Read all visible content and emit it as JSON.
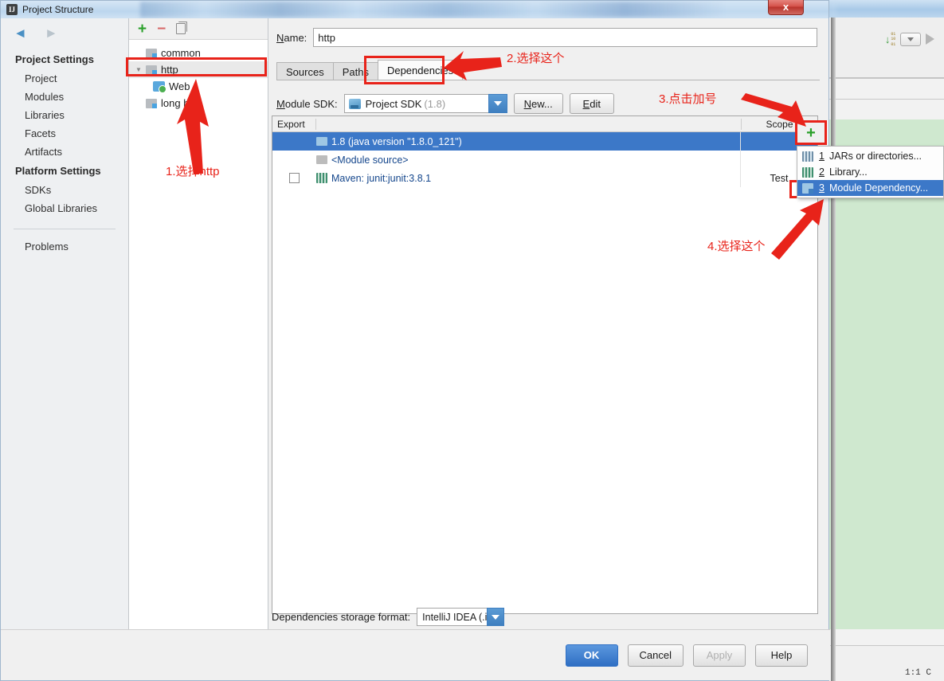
{
  "background": {
    "status_text": "1:1  C",
    "icons": [
      "binary-download-icon",
      "dropdown-icon",
      "run-icon"
    ]
  },
  "dialog": {
    "title": "Project Structure",
    "app_icon": "IJ",
    "close_label": "x"
  },
  "sidebar": {
    "back_icon": "◄",
    "forward_icon": "►",
    "groups": [
      {
        "title": "Project Settings",
        "items": [
          "Project",
          "Modules",
          "Libraries",
          "Facets",
          "Artifacts"
        ]
      },
      {
        "title": "Platform Settings",
        "items": [
          "SDKs",
          "Global Libraries"
        ]
      }
    ],
    "footer_items": [
      "Problems"
    ]
  },
  "module_tree": {
    "toolbar": {
      "add": "+",
      "remove": "−",
      "copy": "copy-icon"
    },
    "nodes": [
      {
        "label": "common",
        "icon": "module-icon",
        "indent": 0,
        "expander": "",
        "selected": false
      },
      {
        "label": "http",
        "icon": "module-icon",
        "indent": 0,
        "expander": "▼",
        "selected": true
      },
      {
        "label": "Web",
        "icon": "web-facet-icon",
        "indent": 1,
        "expander": "",
        "selected": false
      },
      {
        "label": "long  bo",
        "icon": "module-icon",
        "indent": 0,
        "expander": "",
        "selected": false
      }
    ]
  },
  "module_editor": {
    "name_label": "Name:",
    "name_label_mnemonic": "N",
    "name_value": "http",
    "tabs": [
      {
        "label": "Sources",
        "active": false
      },
      {
        "label": "Paths",
        "active": false
      },
      {
        "label": "Dependencies",
        "active": true
      }
    ],
    "sdk": {
      "label": "Module SDK:",
      "label_mnemonic": "M",
      "value": "Project SDK",
      "value_dim": "(1.8)",
      "new_button": "New...",
      "new_button_mnemonic": "N",
      "edit_button": "Edit",
      "edit_button_mnemonic": "E"
    },
    "table": {
      "columns": [
        "Export",
        "Scope"
      ],
      "rows": [
        {
          "export": null,
          "icon": "jdk-icon",
          "label": "1.8 (java version \"1.8.0_121\")",
          "scope": "",
          "selected": true
        },
        {
          "export": null,
          "icon": "folder-icon",
          "label": "<Module source>",
          "scope": "",
          "selected": false
        },
        {
          "export": false,
          "icon": "library-icon",
          "label": "Maven: junit:junit:3.8.1",
          "scope": "Test",
          "selected": false
        }
      ]
    },
    "add_button": "+",
    "add_menu": [
      {
        "num": "1",
        "label": "JARs or directories...",
        "icon": "jars-icon",
        "highlighted": false
      },
      {
        "num": "2",
        "label": "Library...",
        "icon": "library-icon",
        "highlighted": false
      },
      {
        "num": "3",
        "label": "Module Dependency...",
        "icon": "module-dependency-icon",
        "highlighted": true
      }
    ],
    "storage": {
      "label": "Dependencies storage format:",
      "value": "IntelliJ IDEA (.iml)"
    }
  },
  "footer": {
    "ok": "OK",
    "cancel": "Cancel",
    "apply": "Apply",
    "help": "Help"
  },
  "annotations": [
    {
      "id": "step1",
      "text": "1.选择http"
    },
    {
      "id": "step2",
      "text": "2.选择这个"
    },
    {
      "id": "step3",
      "text": "3.点击加号"
    },
    {
      "id": "step4",
      "text": "4.选择这个"
    }
  ],
  "colors": {
    "annotation_red": "#e8231a",
    "selection_blue": "#3c78c8",
    "accent_green": "#2aa02a",
    "link_blue": "#14468c"
  }
}
